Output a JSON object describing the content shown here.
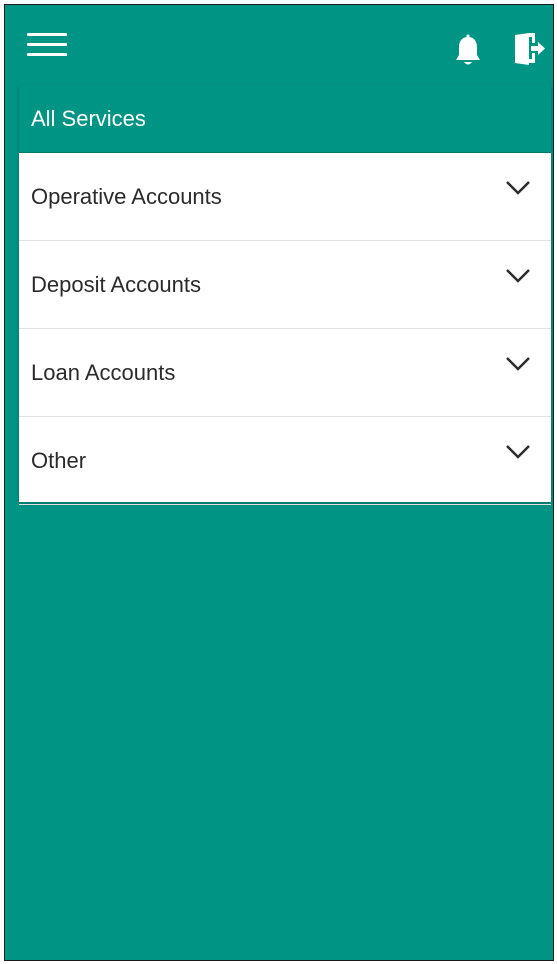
{
  "topbar": {
    "menu_icon": "hamburger-menu-icon",
    "notification_icon": "bell-icon",
    "logout_icon": "logout-door-icon"
  },
  "panel": {
    "title": "All Services",
    "items": [
      {
        "label": "Operative Accounts",
        "icon": "chevron-down-icon"
      },
      {
        "label": "Deposit Accounts",
        "icon": "chevron-down-icon"
      },
      {
        "label": "Loan Accounts",
        "icon": "chevron-down-icon"
      },
      {
        "label": "Other",
        "icon": "chevron-down-icon"
      }
    ]
  },
  "colors": {
    "primary": "#009485",
    "surface": "#ffffff",
    "text": "#2b2b2b",
    "divider": "#e1e1e1"
  }
}
